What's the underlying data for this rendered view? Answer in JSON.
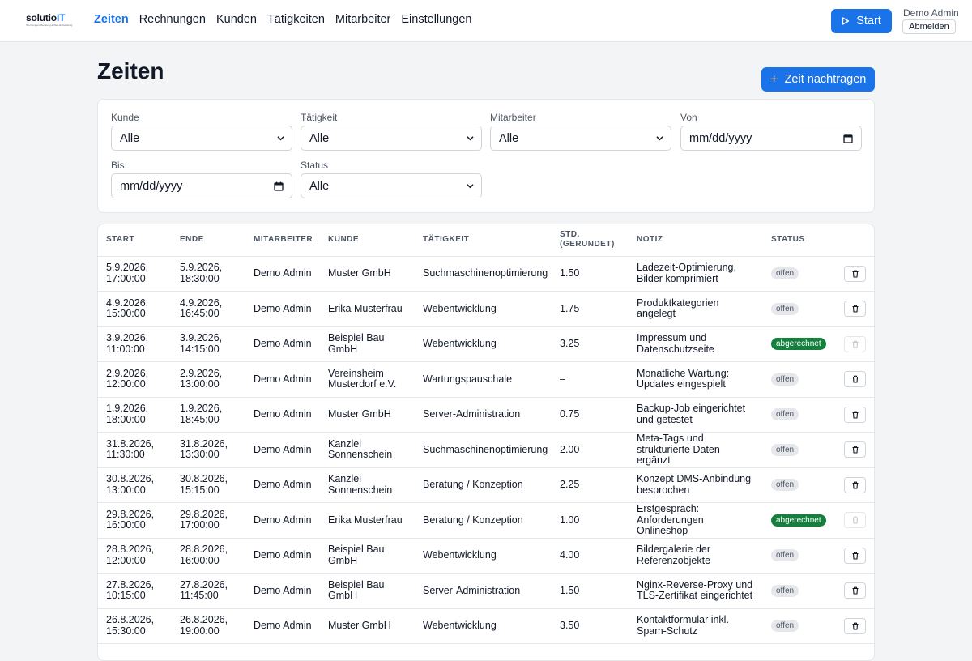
{
  "brand": {
    "name_main": "solutio",
    "name_hl": "IT",
    "tagline": "IT-Lösungen, Beratung & Web-Entwicklung"
  },
  "nav": [
    {
      "label": "Zeiten",
      "active": true
    },
    {
      "label": "Rechnungen",
      "active": false
    },
    {
      "label": "Kunden",
      "active": false
    },
    {
      "label": "Tätigkeiten",
      "active": false
    },
    {
      "label": "Mitarbeiter",
      "active": false
    },
    {
      "label": "Einstellungen",
      "active": false
    }
  ],
  "header": {
    "start_label": "Start",
    "user_name": "Demo Admin",
    "logout_label": "Abmelden"
  },
  "page": {
    "title": "Zeiten",
    "add_label": "Zeit nachtragen"
  },
  "filters": {
    "kunde": {
      "label": "Kunde",
      "value": "Alle"
    },
    "taetigkeit": {
      "label": "Tätigkeit",
      "value": "Alle"
    },
    "mitarbeiter": {
      "label": "Mitarbeiter",
      "value": "Alle"
    },
    "von": {
      "label": "Von",
      "value": "mm/dd/yyyy"
    },
    "bis": {
      "label": "Bis",
      "value": "mm/dd/yyyy"
    },
    "status": {
      "label": "Status",
      "value": "Alle"
    }
  },
  "table": {
    "columns": [
      "Start",
      "Ende",
      "Mitarbeiter",
      "Kunde",
      "Tätigkeit",
      "Std. (gerundet)",
      "Notiz",
      "Status"
    ],
    "rows": [
      {
        "start": "5.9.2026, 17:00:00",
        "ende": "5.9.2026, 18:30:00",
        "mitarbeiter": "Demo Admin",
        "kunde": "Muster GmbH",
        "taetigkeit": "Suchmaschinenoptimierung",
        "std": "1.50",
        "notiz": "Ladezeit-Optimierung, Bilder komprimiert",
        "status": "offen"
      },
      {
        "start": "4.9.2026, 15:00:00",
        "ende": "4.9.2026, 16:45:00",
        "mitarbeiter": "Demo Admin",
        "kunde": "Erika Musterfrau",
        "taetigkeit": "Webentwicklung",
        "std": "1.75",
        "notiz": "Produktkategorien angelegt",
        "status": "offen"
      },
      {
        "start": "3.9.2026, 11:00:00",
        "ende": "3.9.2026, 14:15:00",
        "mitarbeiter": "Demo Admin",
        "kunde": "Beispiel Bau GmbH",
        "taetigkeit": "Webentwicklung",
        "std": "3.25",
        "notiz": "Impressum und Datenschutzseite",
        "status": "abgerechnet"
      },
      {
        "start": "2.9.2026, 12:00:00",
        "ende": "2.9.2026, 13:00:00",
        "mitarbeiter": "Demo Admin",
        "kunde": "Vereinsheim Musterdorf e.V.",
        "taetigkeit": "Wartungspauschale",
        "std": "–",
        "notiz": "Monatliche Wartung: Updates eingespielt",
        "status": "offen"
      },
      {
        "start": "1.9.2026, 18:00:00",
        "ende": "1.9.2026, 18:45:00",
        "mitarbeiter": "Demo Admin",
        "kunde": "Muster GmbH",
        "taetigkeit": "Server-Administration",
        "std": "0.75",
        "notiz": "Backup-Job eingerichtet und getestet",
        "status": "offen"
      },
      {
        "start": "31.8.2026, 11:30:00",
        "ende": "31.8.2026, 13:30:00",
        "mitarbeiter": "Demo Admin",
        "kunde": "Kanzlei Sonnenschein",
        "taetigkeit": "Suchmaschinenoptimierung",
        "std": "2.00",
        "notiz": "Meta-Tags und strukturierte Daten ergänzt",
        "status": "offen"
      },
      {
        "start": "30.8.2026, 13:00:00",
        "ende": "30.8.2026, 15:15:00",
        "mitarbeiter": "Demo Admin",
        "kunde": "Kanzlei Sonnenschein",
        "taetigkeit": "Beratung / Konzeption",
        "std": "2.25",
        "notiz": "Konzept DMS-Anbindung besprochen",
        "status": "offen"
      },
      {
        "start": "29.8.2026, 16:00:00",
        "ende": "29.8.2026, 17:00:00",
        "mitarbeiter": "Demo Admin",
        "kunde": "Erika Musterfrau",
        "taetigkeit": "Beratung / Konzeption",
        "std": "1.00",
        "notiz": "Erstgespräch: Anforderungen Onlineshop",
        "status": "abgerechnet"
      },
      {
        "start": "28.8.2026, 12:00:00",
        "ende": "28.8.2026, 16:00:00",
        "mitarbeiter": "Demo Admin",
        "kunde": "Beispiel Bau GmbH",
        "taetigkeit": "Webentwicklung",
        "std": "4.00",
        "notiz": "Bildergalerie der Referenzobjekte",
        "status": "offen"
      },
      {
        "start": "27.8.2026, 10:15:00",
        "ende": "27.8.2026, 11:45:00",
        "mitarbeiter": "Demo Admin",
        "kunde": "Beispiel Bau GmbH",
        "taetigkeit": "Server-Administration",
        "std": "1.50",
        "notiz": "Nginx-Reverse-Proxy und TLS-Zertifikat eingerichtet",
        "status": "offen"
      },
      {
        "start": "26.8.2026, 15:30:00",
        "ende": "26.8.2026, 19:00:00",
        "mitarbeiter": "Demo Admin",
        "kunde": "Muster GmbH",
        "taetigkeit": "Webentwicklung",
        "std": "3.50",
        "notiz": "Kontaktformular inkl. Spam-Schutz",
        "status": "offen"
      }
    ]
  },
  "colors": {
    "accent": "#1a73e8",
    "status_abgerechnet": "#15803d",
    "status_offen": "#e5e7eb"
  }
}
